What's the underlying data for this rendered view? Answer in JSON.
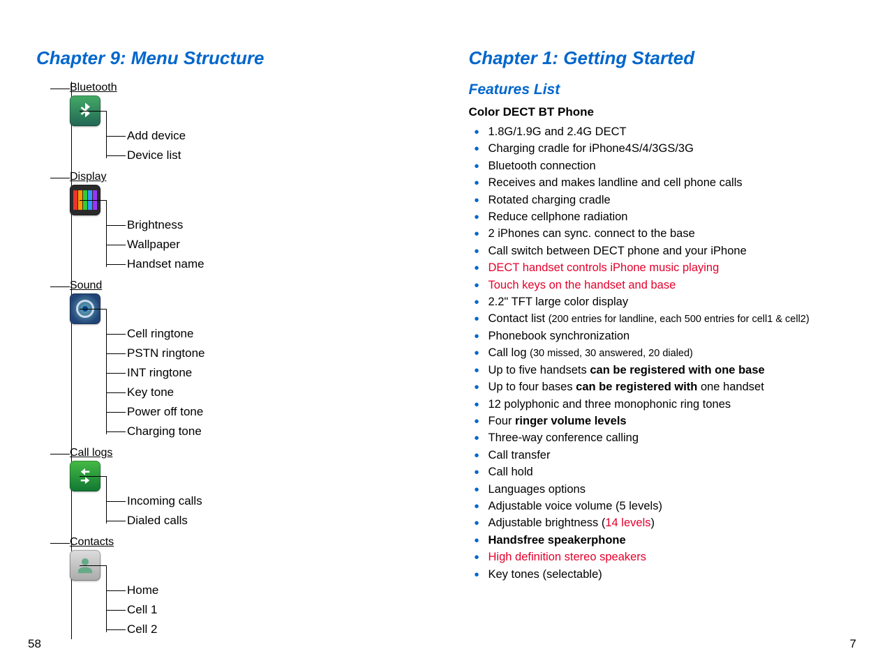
{
  "left": {
    "chapter": "Chapter 9: Menu Structure",
    "groups": [
      {
        "label": "Bluetooth",
        "icon": "bluetooth-icon",
        "items": [
          "Add device",
          "Device list"
        ]
      },
      {
        "label": "Display",
        "icon": "display-icon",
        "items": [
          "Brightness",
          "Wallpaper",
          "Handset name"
        ]
      },
      {
        "label": "Sound",
        "icon": "sound-icon",
        "items": [
          "Cell ringtone",
          "PSTN ringtone",
          "INT ringtone",
          "Key tone",
          "Power off tone",
          "Charging tone"
        ]
      },
      {
        "label": "Call logs",
        "icon": "call-logs-icon",
        "items": [
          "Incoming calls",
          "Dialed calls"
        ]
      },
      {
        "label": "Contacts",
        "icon": "contacts-icon",
        "items": [
          "Home",
          "Cell 1",
          "Cell 2"
        ]
      }
    ],
    "pagenum": "58"
  },
  "right": {
    "chapter": "Chapter 1: Getting Started",
    "section": "Features List",
    "subhead": "Color DECT BT Phone",
    "features": [
      {
        "parts": [
          {
            "t": "1.8G/1.9G and 2.4G DECT"
          }
        ]
      },
      {
        "parts": [
          {
            "t": "Charging cradle for iPhone4S/4/3GS/3G"
          }
        ]
      },
      {
        "parts": [
          {
            "t": "Bluetooth connection"
          }
        ]
      },
      {
        "parts": [
          {
            "t": "Receives and makes landline and cell phone calls"
          }
        ]
      },
      {
        "parts": [
          {
            "t": "Rotated charging cradle"
          }
        ]
      },
      {
        "parts": [
          {
            "t": "Reduce cellphone radiation"
          }
        ]
      },
      {
        "parts": [
          {
            "t": "2 iPhones can sync. connect to the base"
          }
        ]
      },
      {
        "parts": [
          {
            "t": "Call switch between DECT phone and your iPhone"
          }
        ]
      },
      {
        "parts": [
          {
            "t": "DECT handset controls iPhone music playing",
            "cls": "red"
          }
        ]
      },
      {
        "parts": [
          {
            "t": "Touch keys on the handset and base",
            "cls": "red"
          }
        ]
      },
      {
        "parts": [
          {
            "t": "2.2\" TFT large color display"
          }
        ]
      },
      {
        "parts": [
          {
            "t": "Contact list "
          },
          {
            "t": "(200 entries for landline, each 500 entries for cell1 & cell2)",
            "cls": "small"
          }
        ]
      },
      {
        "parts": [
          {
            "t": "Phonebook synchronization"
          }
        ]
      },
      {
        "parts": [
          {
            "t": "Call log "
          },
          {
            "t": "(30 missed, 30 answered, 20 dialed)",
            "cls": "small"
          }
        ]
      },
      {
        "parts": [
          {
            "t": "Up to five handsets "
          },
          {
            "t": "can be registered with one base",
            "cls": "bold"
          }
        ]
      },
      {
        "parts": [
          {
            "t": "Up to four bases "
          },
          {
            "t": "can be registered with",
            "cls": "bold"
          },
          {
            "t": " one handset"
          }
        ]
      },
      {
        "parts": [
          {
            "t": "12 polyphonic and three monophonic ring tones"
          }
        ]
      },
      {
        "parts": [
          {
            "t": "Four "
          },
          {
            "t": "ringer volume levels",
            "cls": "bold"
          }
        ]
      },
      {
        "parts": [
          {
            "t": "Three-way conference calling"
          }
        ]
      },
      {
        "parts": [
          {
            "t": "Call transfer"
          }
        ]
      },
      {
        "parts": [
          {
            "t": "Call hold"
          }
        ]
      },
      {
        "parts": [
          {
            "t": "Languages options"
          }
        ]
      },
      {
        "parts": [
          {
            "t": "Adjustable voice volume (5 levels)"
          }
        ]
      },
      {
        "parts": [
          {
            "t": "Adjustable brightness ("
          },
          {
            "t": "14 levels",
            "cls": "red"
          },
          {
            "t": ")"
          }
        ]
      },
      {
        "parts": [
          {
            "t": "Handsfree speakerphone",
            "cls": "bold"
          }
        ]
      },
      {
        "parts": [
          {
            "t": "High definition stereo speakers",
            "cls": "red"
          }
        ]
      },
      {
        "parts": [
          {
            "t": "Key tones (selectable)"
          }
        ]
      }
    ],
    "pagenum": "7"
  }
}
